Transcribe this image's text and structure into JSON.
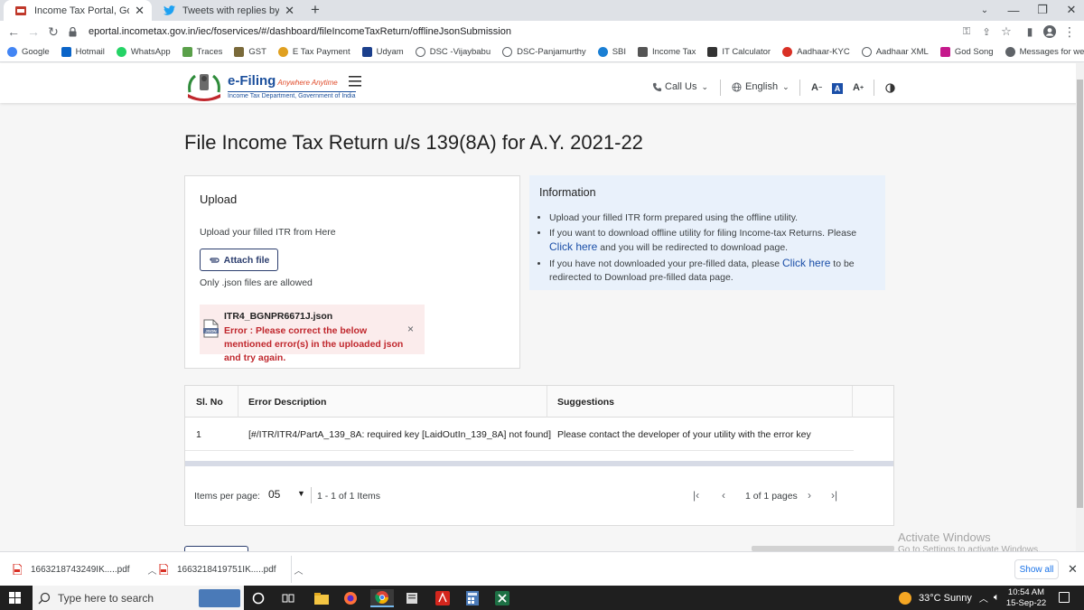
{
  "browser": {
    "tabs": [
      {
        "title": "Income Tax Portal, Government o"
      },
      {
        "title": "Tweets with replies by Income Ta"
      }
    ],
    "url": "eportal.incometax.gov.in/iec/foservices/#/dashboard/fileIncomeTaxReturn/offlineJsonSubmission",
    "bookmarks": [
      {
        "label": "Google",
        "color": "#4285f4"
      },
      {
        "label": "Hotmail",
        "color": "#0a64c8"
      },
      {
        "label": "WhatsApp",
        "color": "#25d366"
      },
      {
        "label": "Traces",
        "color": "#5aa04a"
      },
      {
        "label": "GST",
        "color": "#7a6a3a"
      },
      {
        "label": "E Tax Payment",
        "color": "#e0a020"
      },
      {
        "label": "Udyam",
        "color": "#1b3f8c"
      },
      {
        "label": "DSC -Vijaybabu",
        "color": "#5f6368"
      },
      {
        "label": "DSC-Panjamurthy",
        "color": "#5f6368"
      },
      {
        "label": "SBI",
        "color": "#1a7fd4"
      },
      {
        "label": "Income Tax",
        "color": "#555555"
      },
      {
        "label": "IT Calculator",
        "color": "#333333"
      },
      {
        "label": "Aadhaar-KYC",
        "color": "#d93025"
      },
      {
        "label": "Aadhaar XML",
        "color": "#5f6368"
      },
      {
        "label": "God Song",
        "color": "#c5198c"
      },
      {
        "label": "Messages for web",
        "color": "#5f6368"
      }
    ]
  },
  "site": {
    "logo_title": "e-Filing",
    "logo_tagline": "Anywhere Anytime",
    "logo_subtitle": "Income Tax Department, Government of India",
    "call_us": "Call Us",
    "language": "English"
  },
  "page": {
    "title": "File Income Tax Return u/s 139(8A) for A.Y. 2021-22"
  },
  "upload": {
    "heading": "Upload",
    "description": "Upload your filled ITR from Here",
    "attach_label": "Attach file",
    "note": "Only .json files are allowed",
    "file_name": "ITR4_BGNPR6671J.json",
    "error_message": "Error : Please correct the below mentioned error(s) in the uploaded json and try again.",
    "close_glyph": "×"
  },
  "info": {
    "heading": "Information",
    "item1": "Upload your filled ITR form prepared using the offline utility.",
    "item2_before": "If you want to download offline utility for filing Income-tax Returns. Please ",
    "item2_link": "Click here",
    "item2_after": " and you will be redirected to download page.",
    "item3_before": "If you have not downloaded your pre-filled data, please ",
    "item3_link": "Click here",
    "item3_after": " to be redirected to Download pre-filled data page."
  },
  "errors_table": {
    "headers": [
      "Sl. No",
      "Error Description",
      "Suggestions"
    ],
    "rows": [
      {
        "sl": "1",
        "description": "[#/ITR/ITR4/PartA_139_8A: required key [LaidOutIn_139_8A] not found]",
        "suggestion": "Please contact the developer of your utility with the error key"
      }
    ],
    "items_per_page_label": "Items per page:",
    "items_per_page": "05",
    "range": "1 - 1 of 1 Items",
    "page_info": "1 of 1 pages"
  },
  "watermark": {
    "line1": "Activate Windows",
    "line2": "Go to Settings to activate Windows."
  },
  "downloads": [
    {
      "name": "1663218743249IK.....pdf"
    },
    {
      "name": "1663218419751IK.....pdf"
    }
  ],
  "shelf": {
    "show_all": "Show all"
  },
  "taskbar": {
    "search_placeholder": "Type here to search",
    "weather": "33°C  Sunny",
    "time": "10:54 AM",
    "date": "15-Sep-22"
  },
  "colors": {
    "accent": "#1b4fa8",
    "error_text": "#c0272d",
    "error_bg": "#fbecec",
    "info_bg": "#e9f1fb"
  }
}
